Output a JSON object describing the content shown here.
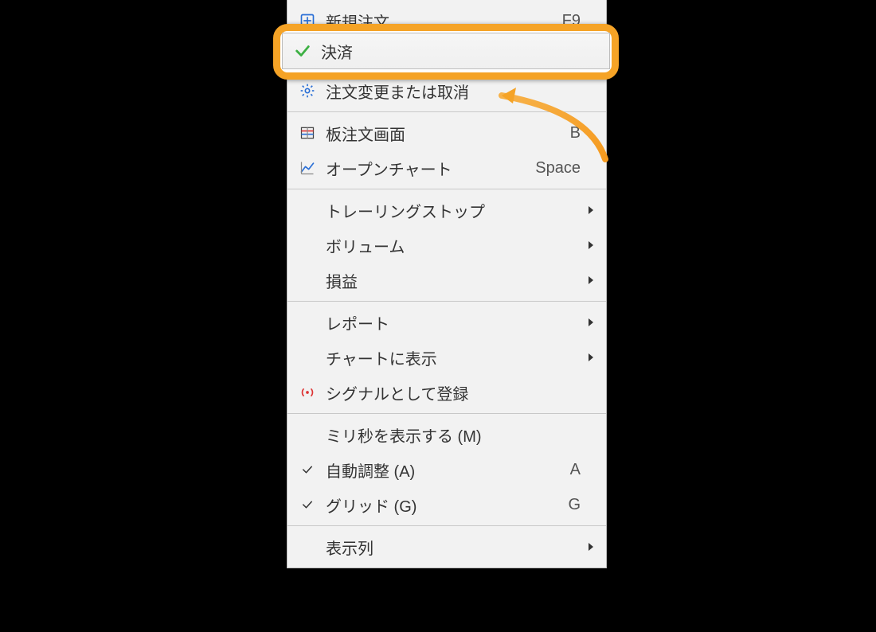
{
  "menu": {
    "items": [
      {
        "id": "new-order",
        "icon": "plus-box-icon",
        "label": "新規注文",
        "shortcut": "F9",
        "submenu": false,
        "checked": false
      },
      {
        "id": "close-position",
        "icon": "check-green-icon",
        "label": "決済",
        "shortcut": "",
        "submenu": false,
        "checked": false,
        "highlighted": true
      },
      {
        "id": "modify-cancel",
        "icon": "gear-icon",
        "label": "注文変更または取消",
        "shortcut": "",
        "submenu": false,
        "checked": false
      },
      {
        "separator": true
      },
      {
        "id": "dom",
        "icon": "dom-icon",
        "label": "板注文画面",
        "shortcut": "B",
        "submenu": false,
        "checked": false
      },
      {
        "id": "open-chart",
        "icon": "chart-icon",
        "label": "オープンチャート",
        "shortcut": "Space",
        "submenu": false,
        "checked": false
      },
      {
        "separator": true
      },
      {
        "id": "trailing-stop",
        "icon": "",
        "label": "トレーリングストップ",
        "shortcut": "",
        "submenu": true,
        "checked": false
      },
      {
        "id": "volume",
        "icon": "",
        "label": "ボリューム",
        "shortcut": "",
        "submenu": true,
        "checked": false
      },
      {
        "id": "profit-loss",
        "icon": "",
        "label": "損益",
        "shortcut": "",
        "submenu": true,
        "checked": false
      },
      {
        "separator": true
      },
      {
        "id": "report",
        "icon": "",
        "label": "レポート",
        "shortcut": "",
        "submenu": true,
        "checked": false
      },
      {
        "id": "show-on-chart",
        "icon": "",
        "label": "チャートに表示",
        "shortcut": "",
        "submenu": true,
        "checked": false
      },
      {
        "id": "register-signal",
        "icon": "signal-icon",
        "label": "シグナルとして登録",
        "shortcut": "",
        "submenu": false,
        "checked": false
      },
      {
        "separator": true
      },
      {
        "id": "show-ms",
        "icon": "",
        "label": "ミリ秒を表示する (M)",
        "shortcut": "",
        "submenu": false,
        "checked": false
      },
      {
        "id": "auto-arrange",
        "icon": "check-thin-icon",
        "label": "自動調整 (A)",
        "shortcut": "A",
        "submenu": false,
        "checked": true
      },
      {
        "id": "grid",
        "icon": "check-thin-icon",
        "label": "グリッド (G)",
        "shortcut": "G",
        "submenu": false,
        "checked": true
      },
      {
        "separator": true
      },
      {
        "id": "columns",
        "icon": "",
        "label": "表示列",
        "shortcut": "",
        "submenu": true,
        "checked": false
      }
    ]
  },
  "highlight": {
    "label": "決済"
  }
}
